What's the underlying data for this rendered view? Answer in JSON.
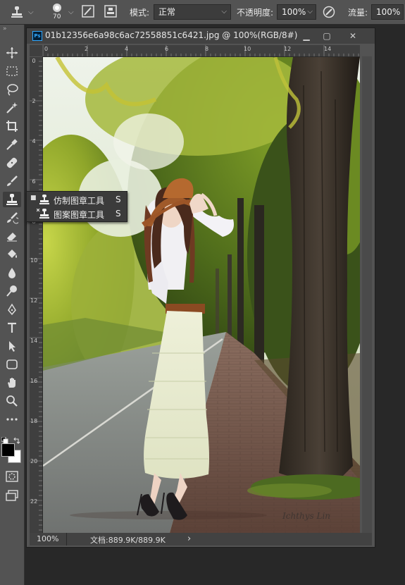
{
  "options_bar": {
    "brush_size": "70",
    "mode_label": "模式:",
    "mode_value": "正常",
    "opacity_label": "不透明度:",
    "opacity_value": "100%",
    "flow_label": "流量:",
    "flow_value": "100%"
  },
  "document": {
    "title": "01b12356e6a98c6ac72558851c6421.jpg @ 100%(RGB/8#)",
    "app_badge": "Ps",
    "zoom": "100%",
    "doc_size": "文档:889.9K/889.9K",
    "status_arrow": "›",
    "ruler_top": [
      "0",
      "2",
      "4",
      "6",
      "8",
      "10",
      "12",
      "14"
    ],
    "ruler_left": [
      "0",
      "2",
      "4",
      "6",
      "8",
      "10",
      "12",
      "14",
      "16",
      "18",
      "20",
      "22"
    ],
    "watermark": "Ichthys Lin"
  },
  "tool_flyout": {
    "items": [
      {
        "label": "仿制图章工具",
        "shortcut": "S",
        "selected": true
      },
      {
        "label": "图案图章工具",
        "shortcut": "S",
        "selected": false
      }
    ]
  },
  "colors": {
    "foreground": "#000000",
    "background": "#ffffff",
    "accent": "#31a8ff"
  }
}
